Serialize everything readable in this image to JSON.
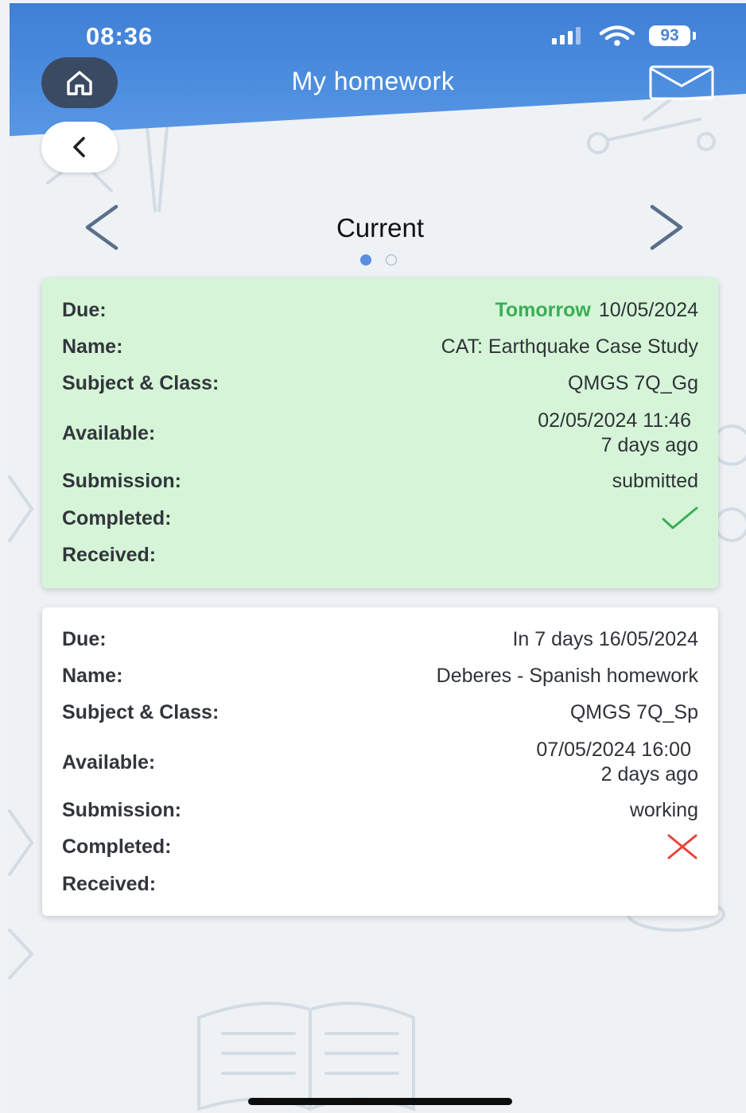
{
  "status_bar": {
    "time": "08:36",
    "battery": "93"
  },
  "header": {
    "title": "My homework"
  },
  "tabs": {
    "label": "Current",
    "page_count": 2,
    "active_index": 0
  },
  "labels": {
    "due": "Due:",
    "name": "Name:",
    "subject": "Subject & Class:",
    "available": "Available:",
    "submission": "Submission:",
    "completed": "Completed:",
    "received": "Received:"
  },
  "homework": [
    {
      "due_relative": "Tomorrow",
      "due_date": "10/05/2024",
      "name": "CAT: Earthquake Case Study",
      "subject_class": "QMGS 7Q_Gg",
      "available_datetime": "02/05/2024 11:46",
      "available_relative": "7 days ago",
      "submission": "submitted",
      "completed": "check-icon",
      "received": "",
      "card_color": "#d6f5d8"
    },
    {
      "due_relative": "",
      "due_date": "In 7 days 16/05/2024",
      "name": "Deberes - Spanish homework",
      "subject_class": "QMGS 7Q_Sp",
      "available_datetime": "07/05/2024 16:00",
      "available_relative": "2 days ago",
      "submission": "working",
      "completed": "cross-icon",
      "received": "",
      "card_color": "#ffffff"
    }
  ],
  "colors": {
    "header": "#4f8fe0",
    "accent_green": "#3aae56",
    "cross_red": "#e8443a",
    "home_button": "#3b4a63"
  }
}
